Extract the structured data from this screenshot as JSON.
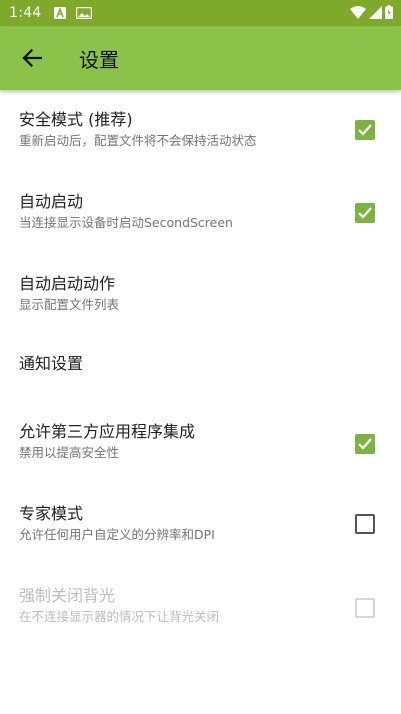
{
  "status_bar": {
    "time": "1:44",
    "icons_left": [
      "a-icon",
      "photo-icon"
    ],
    "icons_right": [
      "wifi-icon",
      "signal-icon",
      "battery-icon"
    ]
  },
  "app_bar": {
    "back_icon": "arrow-left-icon",
    "title": "设置"
  },
  "preferences": [
    {
      "title": "安全模式 (推荐)",
      "summary": "重新启动后，配置文件将不会保持活动状态",
      "checkbox": "checked",
      "enabled": true
    },
    {
      "title": "自动启动",
      "summary": "当连接显示设备时启动SecondScreen",
      "checkbox": "checked",
      "enabled": true
    },
    {
      "title": "自动启动动作",
      "summary": "显示配置文件列表",
      "checkbox": null,
      "enabled": true
    },
    {
      "title": "通知设置",
      "summary": "",
      "checkbox": null,
      "enabled": true
    },
    {
      "title": "允许第三方应用程序集成",
      "summary": "禁用以提高安全性",
      "checkbox": "checked",
      "enabled": true
    },
    {
      "title": "专家模式",
      "summary": "允许任何用户自定义的分辨率和DPI",
      "checkbox": "unchecked",
      "enabled": true
    },
    {
      "title": "强制关闭背光",
      "summary": "在不连接显示器的情况下让背光关闭",
      "checkbox": "unchecked",
      "enabled": false
    }
  ],
  "colors": {
    "status_bar": "#7ea92b",
    "app_bar": "#8bc34a",
    "checkbox_checked": "#7cb342",
    "text_primary": "#222222",
    "text_secondary": "#757575",
    "text_disabled": "#bdbdbd"
  }
}
